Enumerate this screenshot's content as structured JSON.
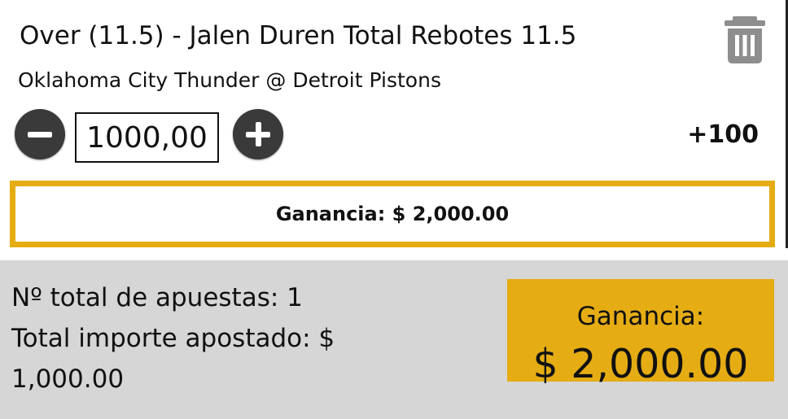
{
  "bet": {
    "title": "Over (11.5) - Jalen Duren Total Rebotes 11.5",
    "match": "Oklahoma City Thunder @ Detroit Pistons",
    "stake_value": "1000,00",
    "odds": "+100",
    "payout_text": "Ganancia: $ 2,000.00",
    "delete_icon": "trash-icon"
  },
  "summary": {
    "total_bets": "Nº total de apuestas: 1",
    "total_staked_line1": "Total importe apostado: $",
    "total_staked_line2": "1,000.00",
    "gain_label": "Ganancia:",
    "gain_amount": "$ 2,000.00"
  },
  "colors": {
    "accent": "#e5ac14",
    "button_dark": "#3a3a3a",
    "footer_bg": "#d6d6d6"
  }
}
